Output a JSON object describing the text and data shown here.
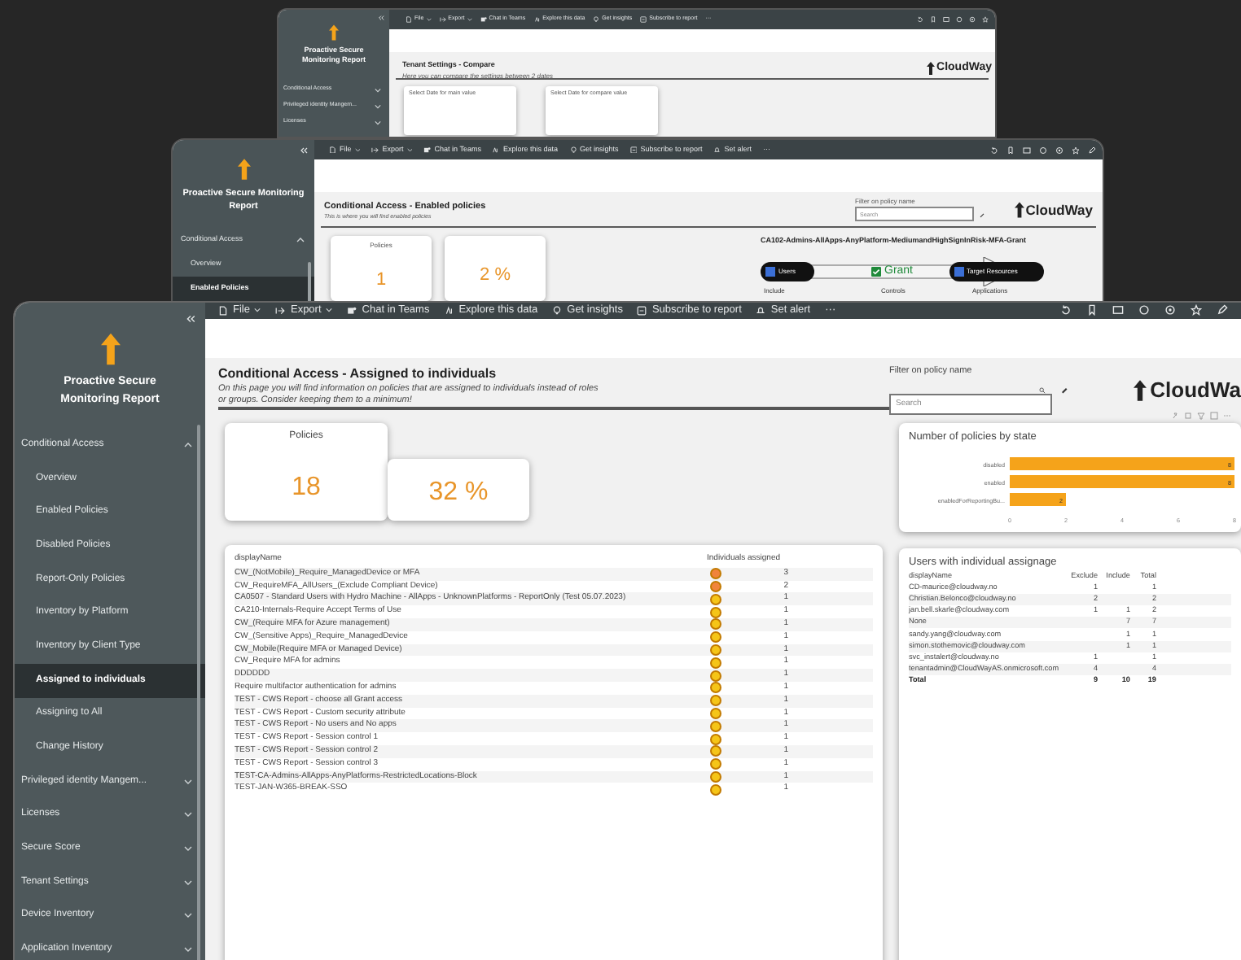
{
  "back_window": {
    "sidebar": {
      "title": "Proactive Secure Monitoring Report",
      "groups": [
        {
          "label": "Conditional Access",
          "expanded": false
        },
        {
          "label": "Privileged identity Mangem...",
          "expanded": false
        },
        {
          "label": "Licenses",
          "expanded": false
        }
      ]
    },
    "toolbar": {
      "items": [
        {
          "label": "File",
          "dropdown": true
        },
        {
          "label": "Export",
          "dropdown": true
        },
        {
          "label": "Chat in Teams",
          "dropdown": false
        },
        {
          "label": "Explore this data",
          "dropdown": false
        },
        {
          "label": "Get insights",
          "dropdown": false
        },
        {
          "label": "Subscribe to report",
          "dropdown": false
        }
      ],
      "more": "···"
    },
    "page": {
      "title": "Tenant Settings - Compare",
      "subtitle": "Here you can compare the settings between 2 dates",
      "logo": "CloudWay",
      "slicers": [
        {
          "title": "Select Date for main value"
        },
        {
          "title": "Select Date for compare value"
        }
      ]
    }
  },
  "middle_window": {
    "sidebar": {
      "title": "Proactive Secure Monitoring Report",
      "groups": [
        {
          "label": "Conditional Access",
          "expanded": true,
          "items": [
            {
              "label": "Overview",
              "selected": false
            },
            {
              "label": "Enabled Policies",
              "selected": true
            }
          ]
        }
      ]
    },
    "toolbar": {
      "items": [
        {
          "label": "File",
          "dropdown": true
        },
        {
          "label": "Export",
          "dropdown": true
        },
        {
          "label": "Chat in Teams",
          "dropdown": false
        },
        {
          "label": "Explore this data",
          "dropdown": false
        },
        {
          "label": "Get insights",
          "dropdown": false
        },
        {
          "label": "Subscribe to report",
          "dropdown": false
        },
        {
          "label": "Set alert",
          "dropdown": false
        }
      ],
      "more": "···"
    },
    "page": {
      "title": "Conditional Access - Enabled policies",
      "subtitle": "This is where you will find enabled policies",
      "filter": {
        "label": "Filter on policy name",
        "placeholder": "Search"
      },
      "logo": "CloudWay",
      "cards": [
        {
          "label": "Policies",
          "value": "1"
        },
        {
          "value": "2 %"
        }
      ],
      "policy_flow": {
        "title": "CA102-Admins-AllApps-AnyPlatform-MediumandHighSignInRisk-MFA-Grant",
        "nodes": [
          {
            "label": "Users",
            "caption": "Include"
          },
          {
            "label": "Grant",
            "caption": "Controls"
          },
          {
            "label": "Target Resources",
            "caption": "Applications"
          }
        ]
      }
    }
  },
  "front_window": {
    "sidebar": {
      "title": "Proactive Secure Monitoring Report",
      "groups": [
        {
          "label": "Conditional Access",
          "expanded": true,
          "items": [
            {
              "label": "Overview",
              "selected": false
            },
            {
              "label": "Enabled Policies",
              "selected": false
            },
            {
              "label": "Disabled Policies",
              "selected": false
            },
            {
              "label": "Report-Only Policies",
              "selected": false
            },
            {
              "label": "Inventory by Platform",
              "selected": false
            },
            {
              "label": "Inventory by Client Type",
              "selected": false
            },
            {
              "label": "Assigned to individuals",
              "selected": true
            },
            {
              "label": "Assigning to All",
              "selected": false
            },
            {
              "label": "Change History",
              "selected": false
            }
          ]
        },
        {
          "label": "Privileged identity Mangem...",
          "expanded": false
        },
        {
          "label": "Licenses",
          "expanded": false
        },
        {
          "label": "Secure Score",
          "expanded": false
        },
        {
          "label": "Tenant Settings",
          "expanded": false
        },
        {
          "label": "Device Inventory",
          "expanded": false
        },
        {
          "label": "Application Inventory",
          "expanded": false
        }
      ]
    },
    "toolbar": {
      "items": [
        {
          "label": "File",
          "dropdown": true
        },
        {
          "label": "Export",
          "dropdown": true
        },
        {
          "label": "Chat in Teams",
          "dropdown": false
        },
        {
          "label": "Explore this data",
          "dropdown": false
        },
        {
          "label": "Get insights",
          "dropdown": false
        },
        {
          "label": "Subscribe to report",
          "dropdown": false
        },
        {
          "label": "Set alert",
          "dropdown": false
        }
      ],
      "more": "···"
    },
    "page": {
      "title": "Conditional Access - Assigned to individuals",
      "subtitle": "On this page you will find information on policies that are assigned to individuals instead of roles or groups. Consider keeping them to a minimum!",
      "filter": {
        "label": "Filter on policy name",
        "placeholder": "Search"
      },
      "logo": "CloudWa",
      "cards": [
        {
          "label": "Policies",
          "value": "18"
        },
        {
          "value": "32 %"
        }
      ],
      "state_chart": {
        "title": "Number of policies by state",
        "chart_data": {
          "type": "bar",
          "orientation": "horizontal",
          "categories": [
            "disabled",
            "enabled",
            "enabledForReportingBu..."
          ],
          "values": [
            8,
            8,
            2
          ],
          "xlim": [
            0,
            8
          ],
          "xticks": [
            0,
            2,
            4,
            6,
            8
          ],
          "data_labels": true
        }
      },
      "policy_table": {
        "columns": [
          "displayName",
          "Individuals assigned"
        ],
        "rows": [
          {
            "name": "CW_(NotMobile)_Require_ManagedDevice or MFA",
            "count": "3",
            "color": "#f0843c"
          },
          {
            "name": "CW_RequireMFA_AllUsers_(Exclude Compliant Device)",
            "count": "2",
            "color": "#f0843c"
          },
          {
            "name": "CA0507 - Standard Users with Hydro Machine - AllApps - UnknownPlatforms - ReportOnly (Test 05.07.2023)",
            "count": "1",
            "color": "#f5c518"
          },
          {
            "name": "CA210-Internals-Require Accept Terms of Use",
            "count": "1",
            "color": "#f5c518"
          },
          {
            "name": "CW_(Require MFA for Azure management)",
            "count": "1",
            "color": "#f5c518"
          },
          {
            "name": "CW_(Sensitive Apps)_Require_ManagedDevice",
            "count": "1",
            "color": "#f5c518"
          },
          {
            "name": "CW_Mobile(Require MFA or Managed Device)",
            "count": "1",
            "color": "#f5c518"
          },
          {
            "name": "CW_Require MFA for admins",
            "count": "1",
            "color": "#f5c518"
          },
          {
            "name": "DDDDDD",
            "count": "1",
            "color": "#f5c518"
          },
          {
            "name": "Require multifactor authentication for admins",
            "count": "1",
            "color": "#f5c518"
          },
          {
            "name": "TEST - CWS Report - choose all Grant access",
            "count": "1",
            "color": "#f5c518"
          },
          {
            "name": "TEST - CWS Report - Custom security attribute",
            "count": "1",
            "color": "#f5c518"
          },
          {
            "name": "TEST - CWS Report - No users and No apps",
            "count": "1",
            "color": "#f5c518"
          },
          {
            "name": "TEST - CWS Report - Session control 1",
            "count": "1",
            "color": "#f5c518"
          },
          {
            "name": "TEST - CWS Report - Session control 2",
            "count": "1",
            "color": "#f5c518"
          },
          {
            "name": "TEST - CWS Report - Session control 3",
            "count": "1",
            "color": "#f5c518"
          },
          {
            "name": "TEST-CA-Admins-AllApps-AnyPlatforms-RestrictedLocations-Block",
            "count": "1",
            "color": "#f5c518"
          },
          {
            "name": "TEST-JAN-W365-BREAK-SSO",
            "count": "1",
            "color": "#f5c518"
          }
        ]
      },
      "users_table": {
        "title": "Users with individual assignage",
        "columns": [
          "displayName",
          "Exclude",
          "Include",
          "Total"
        ],
        "rows": [
          [
            "CD-maurice@cloudway.no",
            "1",
            "",
            "1"
          ],
          [
            "Christian.Belonco@cloudway.no",
            "2",
            "",
            "2"
          ],
          [
            "jan.bell.skarle@cloudway.com",
            "1",
            "1",
            "2"
          ],
          [
            "None",
            "",
            "7",
            "7"
          ],
          [
            "sandy.yang@cloudway.com",
            "",
            "1",
            "1"
          ],
          [
            "simon.stothemovic@cloudway.com",
            "",
            "1",
            "1"
          ],
          [
            "svc_instalert@cloudway.no",
            "1",
            "",
            "1"
          ],
          [
            "tenantadmin@CloudWayAS.onmicrosoft.com",
            "4",
            "",
            "4"
          ]
        ],
        "total": [
          "Total",
          "9",
          "10",
          "19"
        ]
      }
    }
  }
}
